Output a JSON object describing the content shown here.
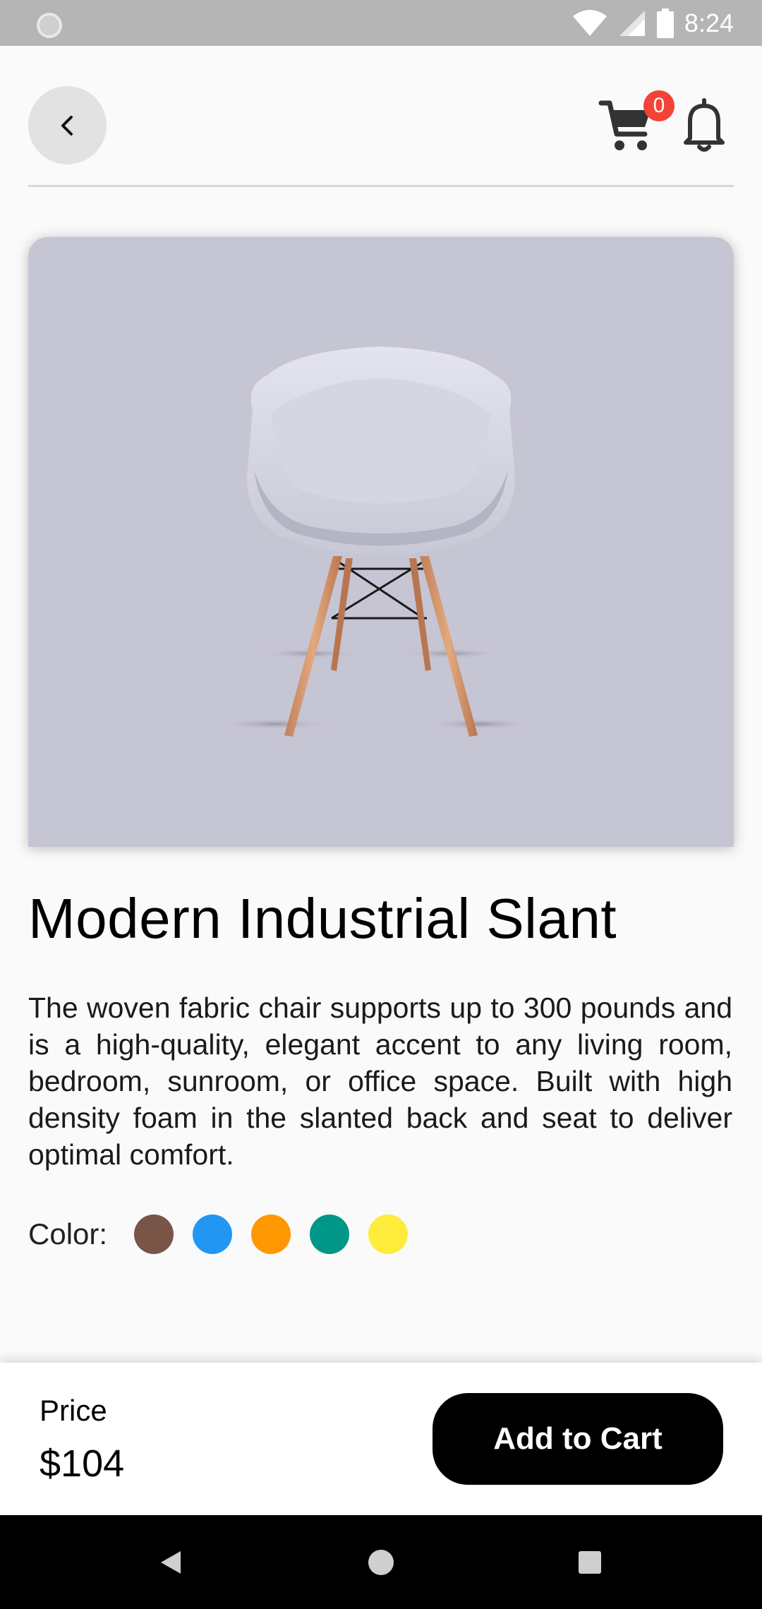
{
  "status_bar": {
    "time": "8:24",
    "icons": [
      "notification-icon",
      "wifi-icon",
      "signal-icon",
      "battery-icon"
    ]
  },
  "header": {
    "back_icon": "chevron-left-icon",
    "cart_icon": "cart-icon",
    "cart_count": "0",
    "bell_icon": "bell-icon"
  },
  "product": {
    "image": "chair-image",
    "title": "Modern Industrial Slant",
    "description": "The woven fabric chair supports up to 300 pounds and is a high-quality, elegant accent to any living room, bedroom, sunroom, or office space. Built with high density foam in the slanted back and seat to deliver optimal comfort.",
    "color_label": "Color:",
    "colors": [
      "#795548",
      "#2196F3",
      "#FF9800",
      "#009688",
      "#FFEB3B"
    ]
  },
  "bottom_bar": {
    "price_label": "Price",
    "price_value": "$104",
    "add_to_cart_label": "Add to Cart"
  },
  "nav_bar": {
    "icons": [
      "back-triangle-icon",
      "home-circle-icon",
      "recents-square-icon"
    ]
  },
  "theme": {
    "background": "#fafafa",
    "image_background": "#c6c5d4",
    "badge": "#f44336",
    "button": "#000000"
  }
}
